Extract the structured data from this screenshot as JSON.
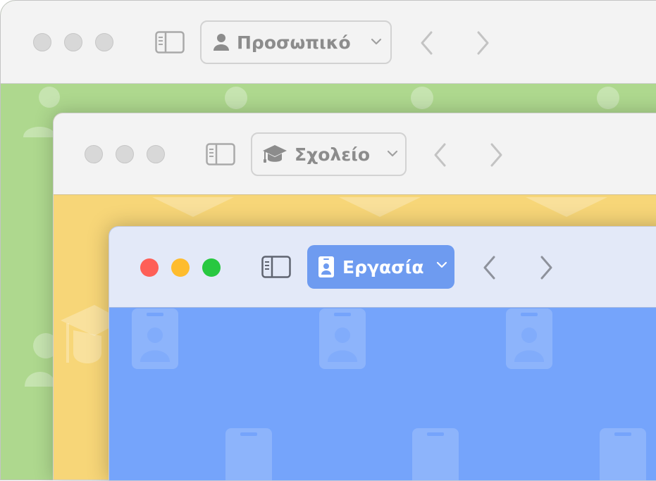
{
  "windows": {
    "personal": {
      "profile_label": "Προσωπικό",
      "profile_icon": "person-icon"
    },
    "school": {
      "profile_label": "Σχολείο",
      "profile_icon": "graduation-cap-icon"
    },
    "work": {
      "profile_label": "Εργασία",
      "profile_icon": "id-badge-icon"
    }
  },
  "colors": {
    "personal_bg": "#aed88e",
    "school_bg": "#f7d678",
    "work_bg": "#75a4fb",
    "work_toolbar": "#e3e9f8",
    "work_profile_button": "#6e9bf0",
    "close": "#fe5f57",
    "minimize": "#febc2e",
    "zoom": "#28c840"
  }
}
